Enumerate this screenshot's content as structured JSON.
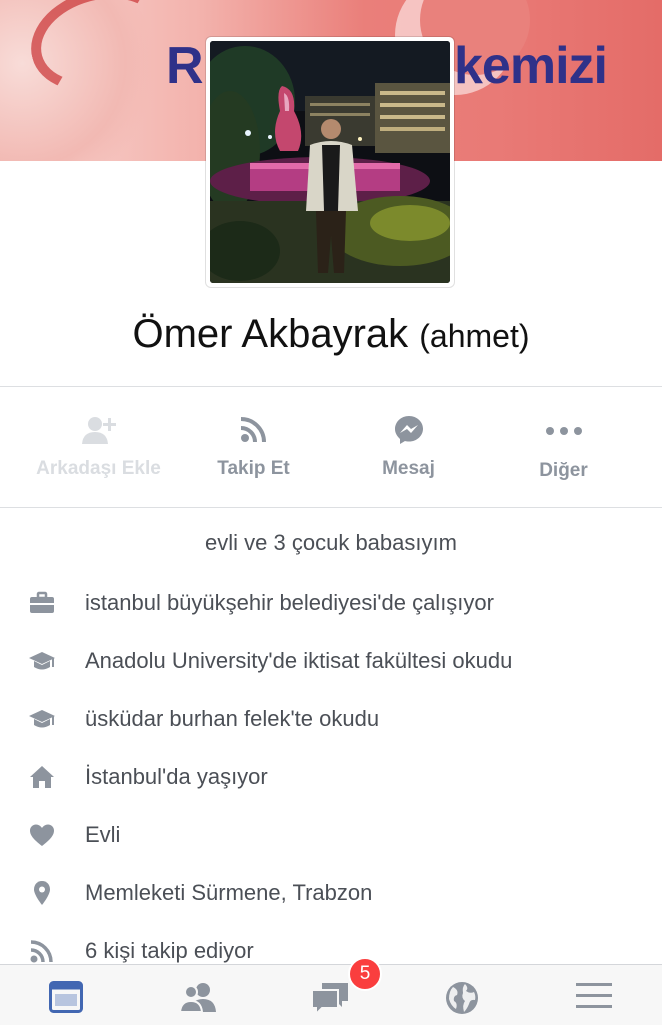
{
  "cover": {
    "text_left": "R",
    "text_right": "kemizi"
  },
  "profile": {
    "name": "Ömer Akbayrak",
    "alt_name": "(ahmet)"
  },
  "actions": [
    {
      "label": "Arkadaşı Ekle",
      "icon": "add-friend-icon",
      "enabled": false
    },
    {
      "label": "Takip Et",
      "icon": "rss-icon",
      "enabled": true
    },
    {
      "label": "Mesaj",
      "icon": "messenger-icon",
      "enabled": true
    },
    {
      "label": "Diğer",
      "icon": "more-icon",
      "enabled": true
    }
  ],
  "bio": "evli ve 3 çocuk babasıyım",
  "info": [
    {
      "icon": "briefcase-icon",
      "text": "istanbul büyükşehir belediyesi'de çalışıyor"
    },
    {
      "icon": "graduation-cap-icon",
      "text": "Anadolu University'de iktisat fakültesi okudu"
    },
    {
      "icon": "graduation-cap-icon",
      "text": "üsküdar burhan felek'te okudu"
    },
    {
      "icon": "home-icon",
      "text": "İstanbul'da yaşıyor"
    },
    {
      "icon": "heart-icon",
      "text": "Evli"
    },
    {
      "icon": "location-pin-icon",
      "text": "Memleketi Sürmene, Trabzon"
    },
    {
      "icon": "rss-icon",
      "text": "6 kişi takip ediyor"
    }
  ],
  "tabbar": {
    "tabs": [
      "news-feed-icon",
      "friends-icon",
      "messages-icon",
      "globe-icon",
      "menu-icon"
    ],
    "messages_badge": "5"
  },
  "colors": {
    "accent": "#4267b2",
    "badge": "#fa3e3e",
    "icon_gray": "#8d949e",
    "text": "#4b4f56"
  }
}
